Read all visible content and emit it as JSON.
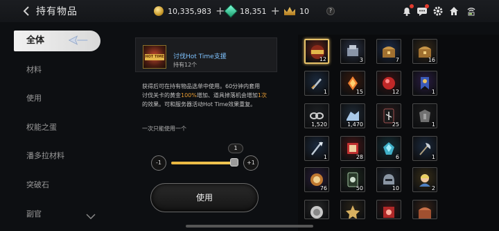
{
  "header": {
    "title": "持有物品",
    "gold": "10,335,983",
    "gems": "18,351",
    "crowns": "10",
    "help": "?"
  },
  "sidebar": {
    "items": [
      {
        "label": "全体"
      },
      {
        "label": "材料"
      },
      {
        "label": "使用"
      },
      {
        "label": "权能之蛋"
      },
      {
        "label": "潘多拉材料"
      },
      {
        "label": "突破石"
      },
      {
        "label": "副官"
      }
    ]
  },
  "detail": {
    "item_name": "讨伐Hot Time支援",
    "item_count": "持有12个",
    "icon_label": "HOT TIME",
    "desc_1": "获得后可在持有物品选单中使用。60分钟内套用",
    "desc_2a": "讨伐关卡的黄金",
    "desc_2b": "100%",
    "desc_2c": "增加、道具掉落机会增加",
    "desc_2d": "1次",
    "desc_3": "的效果。可和服务器活动Hot Time效果重复。",
    "once_note": "一次只能使用一个",
    "qty_value": "1",
    "minus_label": "-1",
    "plus_label": "+1",
    "slider_fraction": 0.95,
    "use_button": "使用"
  },
  "grid": {
    "items": [
      {
        "count": "12",
        "color": "#6b2418",
        "icon": "hot-time-ticket",
        "selected": true
      },
      {
        "count": "3",
        "color": "#2c3447",
        "icon": "armor-box"
      },
      {
        "count": "7",
        "color": "#1c2c4a",
        "icon": "treasure-chest"
      },
      {
        "count": "16",
        "color": "#3a2c18",
        "icon": "treasure-chest"
      },
      {
        "count": "1",
        "color": "#1b2a3e",
        "icon": "sword"
      },
      {
        "count": "15",
        "color": "#3a1a0c",
        "icon": "fire-crystal"
      },
      {
        "count": "12",
        "color": "#3b1212",
        "icon": "red-gem"
      },
      {
        "count": "1",
        "color": "#2a1c44",
        "icon": "banner"
      },
      {
        "count": "1,520",
        "color": "#1e2124",
        "icon": "chain"
      },
      {
        "count": "1,470",
        "color": "#1f2a36",
        "icon": "ore"
      },
      {
        "count": "25",
        "color": "#2a1c1c",
        "icon": "rune-card"
      },
      {
        "count": "1",
        "color": "#1c1c1c",
        "icon": "dark-armor"
      },
      {
        "count": "1",
        "color": "#1b2a3e",
        "icon": "spear"
      },
      {
        "count": "28",
        "color": "#4a1616",
        "icon": "red-book"
      },
      {
        "count": "6",
        "color": "#14323a",
        "icon": "blue-stone"
      },
      {
        "count": "1",
        "color": "#1b2a3e",
        "icon": "axe"
      },
      {
        "count": "76",
        "color": "#2a1c3a",
        "icon": "medal"
      },
      {
        "count": "50",
        "color": "#1e2a1e",
        "icon": "card"
      },
      {
        "count": "10",
        "color": "#20262e",
        "icon": "helmet"
      },
      {
        "count": "2",
        "color": "#3a3018",
        "icon": "portrait"
      },
      {
        "count": "",
        "color": "#2a2a2a",
        "icon": "silver-coin"
      },
      {
        "count": "",
        "color": "#2a2418",
        "icon": "gold-emblem"
      },
      {
        "count": "",
        "color": "#3a1414",
        "icon": "red-item"
      },
      {
        "count": "",
        "color": "#3a2418",
        "icon": "chest"
      }
    ]
  }
}
